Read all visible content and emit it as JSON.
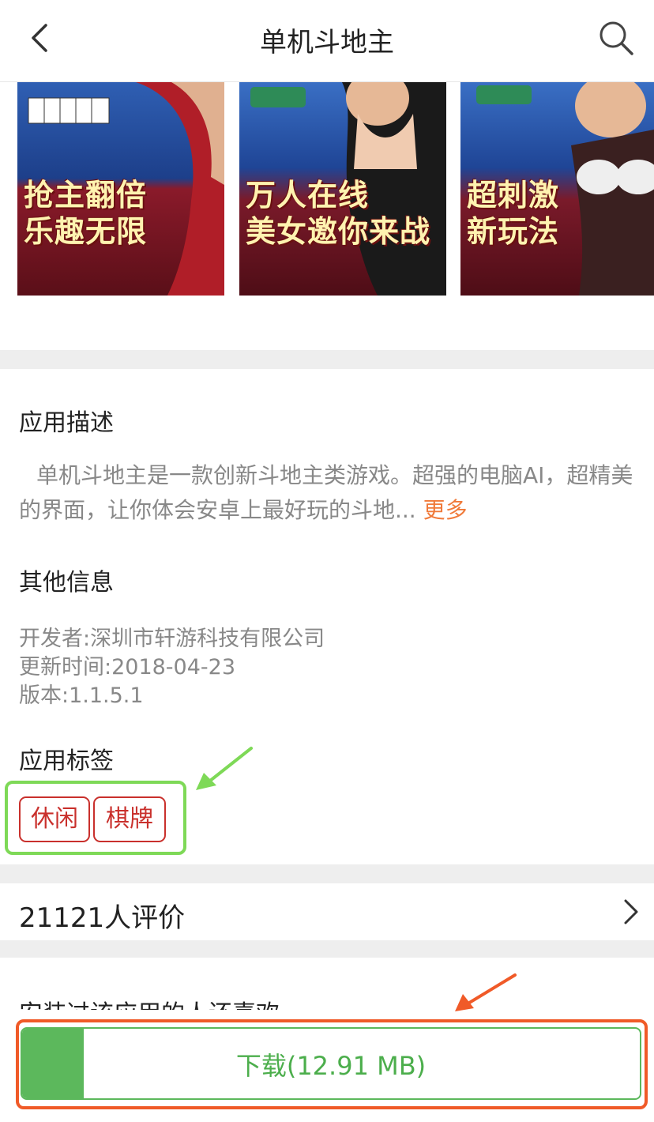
{
  "header": {
    "title": "单机斗地主",
    "back_icon": "chevron-left-icon",
    "search_icon": "search-icon"
  },
  "screenshots": [
    {
      "caption_line1": "抢主翻倍",
      "caption_line2": "乐趣无限"
    },
    {
      "caption_line1": "万人在线",
      "caption_line2": "美女邀你来战"
    },
    {
      "caption_line1": "超刺激",
      "caption_line2": "新玩法"
    }
  ],
  "description": {
    "title": "应用描述",
    "text": "单机斗地主是一款创新斗地主类游戏。超强的电脑AI，超精美的界面，让你体会安卓上最好玩的斗地...",
    "more_label": "更多"
  },
  "other_info": {
    "title": "其他信息",
    "developer": "开发者:深圳市轩游科技有限公司",
    "updated": "更新时间:2018-04-23",
    "version": "版本:1.1.5.1"
  },
  "tags": {
    "title": "应用标签",
    "items": [
      "休闲",
      "棋牌"
    ]
  },
  "ratings": {
    "label": "21121人评价"
  },
  "related": {
    "title": "安装过该应用的人还喜欢"
  },
  "download": {
    "label": "下载(12.91 MB)",
    "progress": 0.1
  },
  "colors": {
    "tag_red": "#c9302c",
    "download_green": "#5cb85c",
    "highlight_green": "#7ed957",
    "highlight_orange": "#f05a28",
    "more_orange": "#f07a3a"
  }
}
